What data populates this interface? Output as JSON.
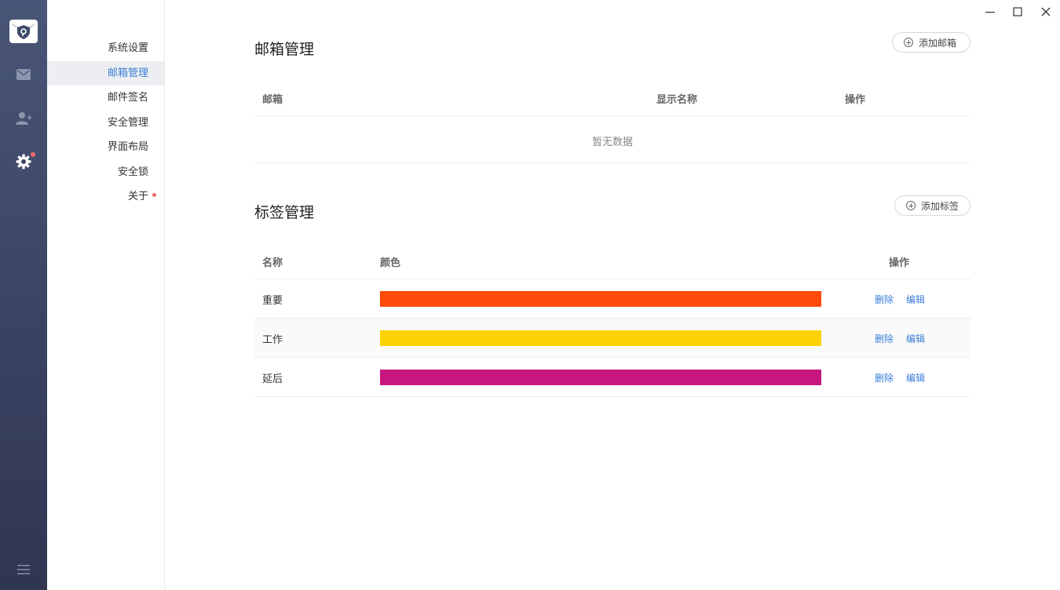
{
  "window": {
    "minimize": "—",
    "maximize": "☐",
    "close": "✕"
  },
  "rail": {
    "logo_icon": "shield-mail-logo",
    "items": [
      {
        "name": "mail",
        "icon": "envelope-icon"
      },
      {
        "name": "contacts",
        "icon": "add-contact-icon"
      },
      {
        "name": "settings",
        "icon": "gear-icon",
        "badge": true
      }
    ],
    "menu_icon": "hamburger-icon"
  },
  "subnav": {
    "items": [
      {
        "label": "系统设置"
      },
      {
        "label": "邮箱管理",
        "active": true
      },
      {
        "label": "邮件签名"
      },
      {
        "label": "安全管理"
      },
      {
        "label": "界面布局"
      },
      {
        "label": "安全锁"
      },
      {
        "label": "关于",
        "badge": true
      }
    ]
  },
  "mailbox": {
    "title": "邮箱管理",
    "add_label": "添加邮箱",
    "columns": {
      "mailbox": "邮箱",
      "display_name": "显示名称",
      "actions": "操作"
    },
    "empty_text": "暂无数据"
  },
  "tags": {
    "title": "标签管理",
    "add_label": "添加标签",
    "columns": {
      "name": "名称",
      "color": "颜色",
      "actions": "操作"
    },
    "rows": [
      {
        "name": "重要",
        "color": "#ff4a0a",
        "delete": "删除",
        "edit": "编辑"
      },
      {
        "name": "工作",
        "color": "#fcd302",
        "delete": "删除",
        "edit": "编辑"
      },
      {
        "name": "延后",
        "color": "#c7177e",
        "delete": "删除",
        "edit": "编辑"
      }
    ]
  }
}
